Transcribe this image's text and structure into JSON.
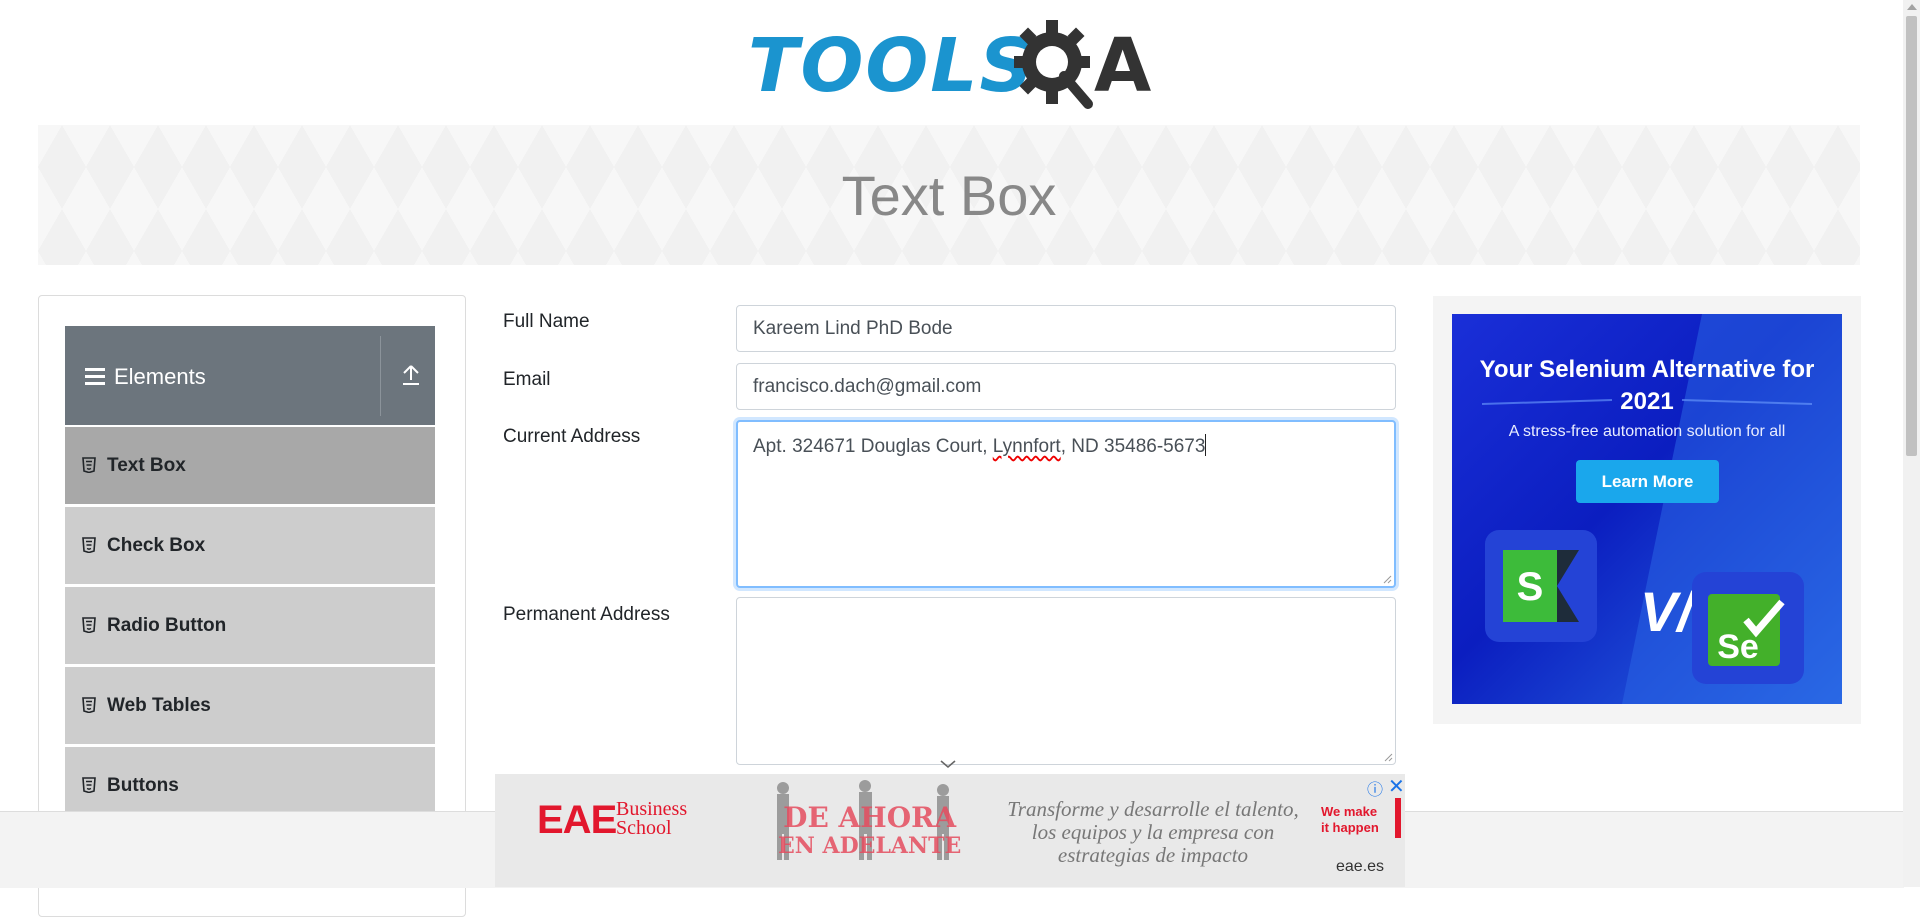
{
  "header": {
    "logo_text": "TOOLS",
    "logo_suffix": "A"
  },
  "banner": {
    "title": "Text Box"
  },
  "sidebar": {
    "group_title": "Elements",
    "items": [
      {
        "label": "Text Box",
        "active": true,
        "icon": "html5-icon"
      },
      {
        "label": "Check Box",
        "active": false,
        "icon": "html5-icon"
      },
      {
        "label": "Radio Button",
        "active": false,
        "icon": "html5-icon"
      },
      {
        "label": "Web Tables",
        "active": false,
        "icon": "html5-icon"
      },
      {
        "label": "Buttons",
        "active": false,
        "icon": "html5-icon"
      }
    ]
  },
  "form": {
    "full_name": {
      "label": "Full Name",
      "value": "Kareem Lind PhD Bode"
    },
    "email": {
      "label": "Email",
      "value": "francisco.dach@gmail.com"
    },
    "current_address": {
      "label": "Current Address",
      "value_before": "Apt. 324671 Douglas Court, ",
      "value_misspelled": "Lynnfort",
      "value_after": ", ND 35486-5673"
    },
    "permanent_address": {
      "label": "Permanent Address",
      "value": ""
    }
  },
  "right_ad": {
    "headline": "Your Selenium Alternative for 2021",
    "subtext": "A stress-free automation solution for all",
    "button": "Learn More",
    "vs": "V/s",
    "left_logo": "S",
    "right_logo": "Se"
  },
  "bottom_ad": {
    "brand": "EAE",
    "brand_school": "Business School",
    "campaign_line1": "DE AHORA",
    "campaign_line2": "EN ADELANTE",
    "slogan": "Transforme y desarrolle el talento, los equipos y la empresa con estrategias de impacto",
    "tag": "We make it happen",
    "domain": "eae.es",
    "adchoices": "ⓘ",
    "close": "✕"
  },
  "colors": {
    "brand_blue": "#1b94cf",
    "sidebar_header": "#6c757d",
    "sidebar_item": "#cdcdcd",
    "sidebar_item_active": "#a8a8a8",
    "focus_border": "#80bdff",
    "eae_red": "#e2172d"
  }
}
